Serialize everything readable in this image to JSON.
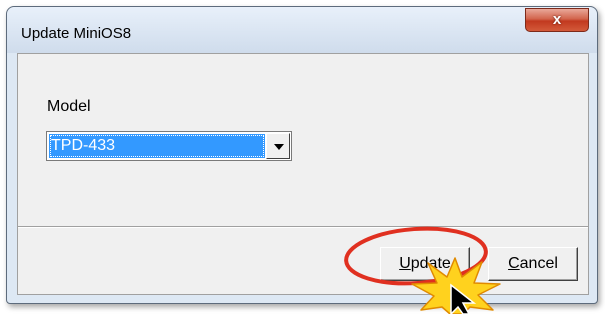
{
  "window": {
    "title": "Update MiniOS8",
    "close_glyph": "x"
  },
  "form": {
    "model_label": "Model",
    "model_value": "TPD-433"
  },
  "buttons": {
    "update_key": "U",
    "update_rest": "pdate",
    "cancel_key": "C",
    "cancel_rest": "ancel"
  },
  "annotation": {
    "highlight_color": "#e03020",
    "burst_color": "#ffd21e",
    "cursor_icon": "arrow-cursor-icon"
  }
}
